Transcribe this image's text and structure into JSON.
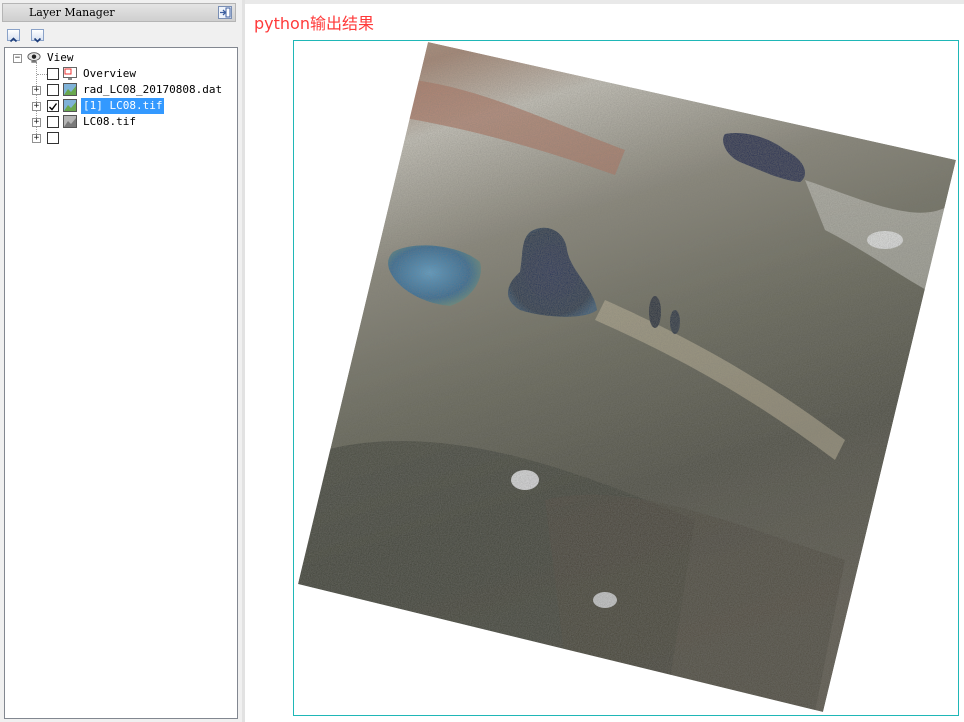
{
  "layer_manager": {
    "title": "Layer Manager",
    "nav_up_icon": "chevron-up-icon",
    "nav_down_icon": "chevron-down-icon",
    "tree": {
      "root_label": "View",
      "items": [
        {
          "label": "Overview",
          "checked": false,
          "icon": "overview-icon"
        },
        {
          "label": "rad_LC08_20170808.dat",
          "checked": false,
          "icon": "raster-color-icon"
        },
        {
          "label": "[1] LC08.tif",
          "checked": true,
          "icon": "raster-color-icon",
          "selected": true
        },
        {
          "label": "LC08.tif",
          "checked": false,
          "icon": "raster-gray-icon"
        },
        {
          "label": "",
          "checked": false,
          "icon": ""
        }
      ]
    }
  },
  "output_panel": {
    "label": "python输出结果",
    "label_color": "#ff3a3a",
    "frame_color": "#1fb7b7",
    "image_description_icon": "satellite-scene-image"
  },
  "colors": {
    "selection": "#3399ff",
    "panel_bg": "#f0f0f0"
  }
}
